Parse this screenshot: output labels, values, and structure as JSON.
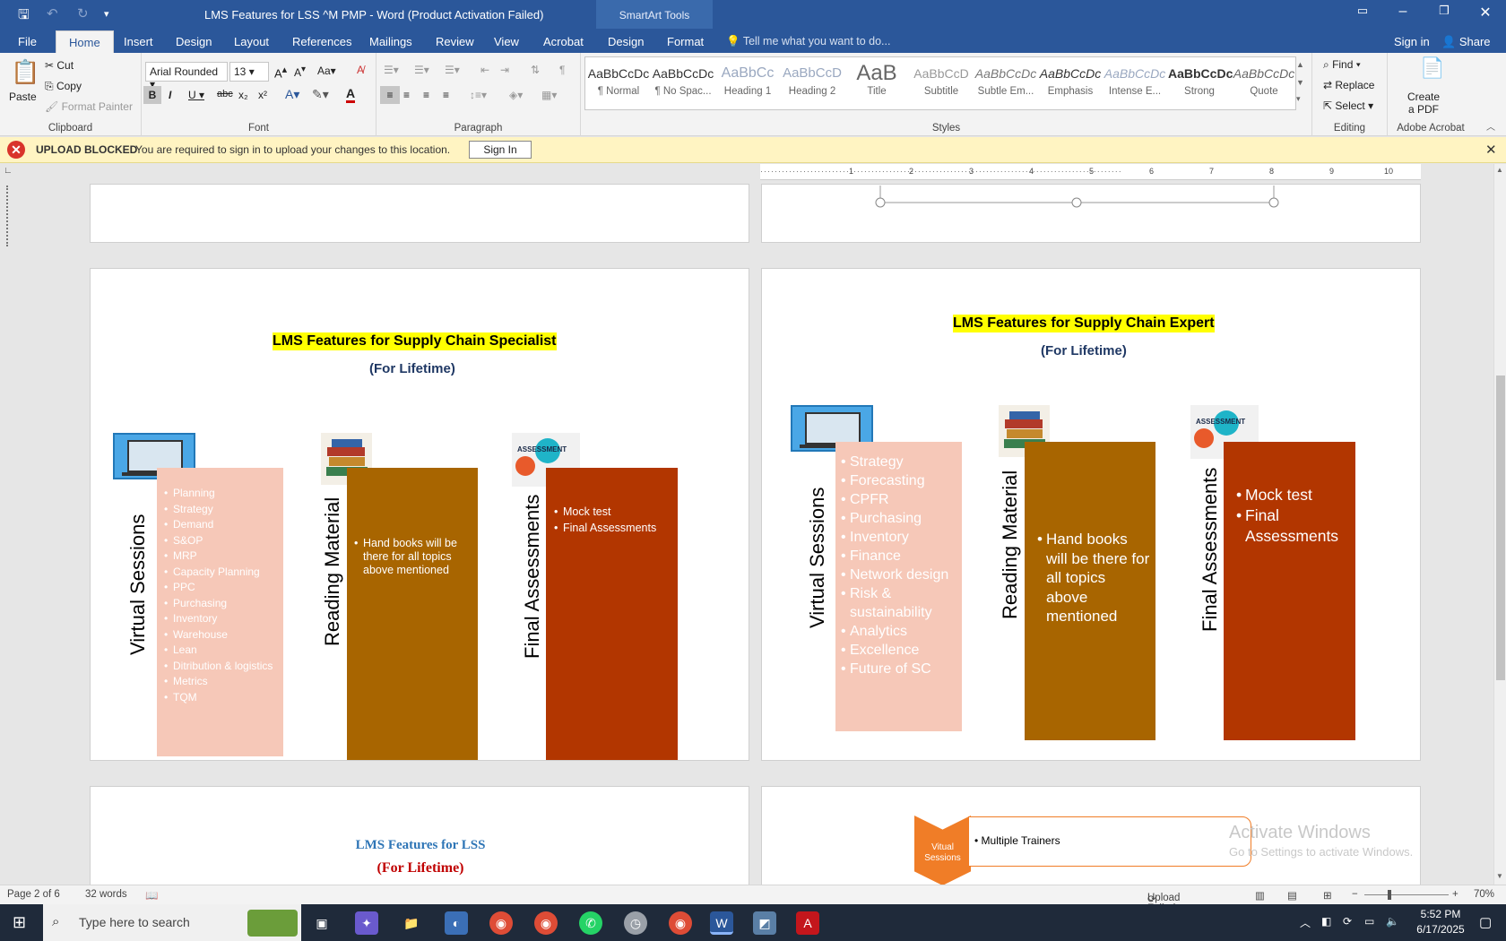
{
  "titlebar": {
    "title": "LMS Features for LSS ^M PMP - Word (Product Activation Failed)",
    "contextual_tab": "SmartArt Tools"
  },
  "tabs": [
    "File",
    "Home",
    "Insert",
    "Design",
    "Layout",
    "References",
    "Mailings",
    "Review",
    "View",
    "Acrobat",
    "Design",
    "Format"
  ],
  "tellme": "Tell me what you want to do...",
  "account": {
    "signin": "Sign in",
    "share": "Share"
  },
  "ribbon": {
    "clipboard": {
      "label": "Clipboard",
      "paste": "Paste",
      "cut": "Cut",
      "copy": "Copy",
      "format_painter": "Format Painter"
    },
    "font": {
      "label": "Font",
      "family": "Arial Rounded",
      "size": "13"
    },
    "paragraph": {
      "label": "Paragraph"
    },
    "styles": {
      "label": "Styles",
      "items": [
        {
          "preview": "AaBbCcDc",
          "name": "¶ Normal"
        },
        {
          "preview": "AaBbCcDc",
          "name": "¶ No Spac..."
        },
        {
          "preview": "AaBbCc",
          "name": "Heading 1"
        },
        {
          "preview": "AaBbCcD",
          "name": "Heading 2"
        },
        {
          "preview": "AaB",
          "name": "Title"
        },
        {
          "preview": "AaBbCcD",
          "name": "Subtitle"
        },
        {
          "preview": "AaBbCcDc",
          "name": "Subtle Em..."
        },
        {
          "preview": "AaBbCcDc",
          "name": "Emphasis"
        },
        {
          "preview": "AaBbCcDc",
          "name": "Intense E..."
        },
        {
          "preview": "AaBbCcDc",
          "name": "Strong"
        },
        {
          "preview": "AaBbCcDc",
          "name": "Quote"
        }
      ]
    },
    "editing": {
      "label": "Editing",
      "find": "Find",
      "replace": "Replace",
      "select": "Select"
    },
    "acrobat": {
      "label": "Adobe Acrobat",
      "create_pdf_1": "Create",
      "create_pdf_2": "a PDF"
    }
  },
  "message_bar": {
    "title": "UPLOAD BLOCKED",
    "text": "You are required to sign in to upload your changes to this location.",
    "button": "Sign In"
  },
  "ruler": [
    "1",
    "2",
    "3",
    "4",
    "5",
    "6",
    "7",
    "8",
    "9",
    "10"
  ],
  "specialist": {
    "title": "LMS Features for Supply Chain Specialist",
    "subtitle": "(For Lifetime)",
    "virtual": {
      "label": "Virtual Sessions",
      "items": [
        "Planning",
        "Strategy",
        "Demand",
        "S&OP",
        "MRP",
        "Capacity Planning",
        "PPC",
        "Purchasing",
        "Inventory",
        "Warehouse",
        "Lean",
        "Ditribution & logistics",
        "Metrics",
        "TQM"
      ]
    },
    "reading": {
      "label": "Reading Material",
      "items": [
        "Hand books will be there for all topics above mentioned"
      ]
    },
    "final": {
      "label": "Final Assessments",
      "items": [
        "Mock test",
        "Final Assessments"
      ]
    }
  },
  "expert": {
    "title": "LMS Features for Supply Chain Expert",
    "subtitle": "(For Lifetime)",
    "virtual": {
      "label": "Virtual Sessions",
      "items": [
        "Strategy",
        "Forecasting",
        " CPFR",
        "Purchasing",
        "Inventory",
        "Finance",
        "Network design",
        "Risk & sustainability",
        "Analytics",
        "Excellence",
        "Future of SC"
      ]
    },
    "reading": {
      "label": "Reading Material",
      "items": [
        "Hand books will be there for all topics above mentioned"
      ]
    },
    "final": {
      "label": "Final Assessments",
      "items": [
        "Mock test",
        "Final Assessments"
      ]
    }
  },
  "lss": {
    "title": "LMS Features for LSS",
    "subtitle": "(For Lifetime)"
  },
  "pmp": {
    "chevron": "Vitual Sessions",
    "item": "Multiple Trainers"
  },
  "assessment_img_text": "ASSESSMENT",
  "watermark": {
    "line1": "Activate Windows",
    "line2": "Go to Settings to activate Windows."
  },
  "status": {
    "page": "Page 2 of 6",
    "words": "32 words",
    "upload": "Upload Failed",
    "zoom": "70%"
  },
  "taskbar": {
    "search": "Type here to search",
    "time": "5:52 PM",
    "date": "6/17/2025"
  },
  "colors": {
    "word_blue": "#2b579a",
    "pink": "#f6c8b8",
    "brown": "#a86500",
    "rust": "#b23600",
    "highlight": "#ffff00"
  }
}
